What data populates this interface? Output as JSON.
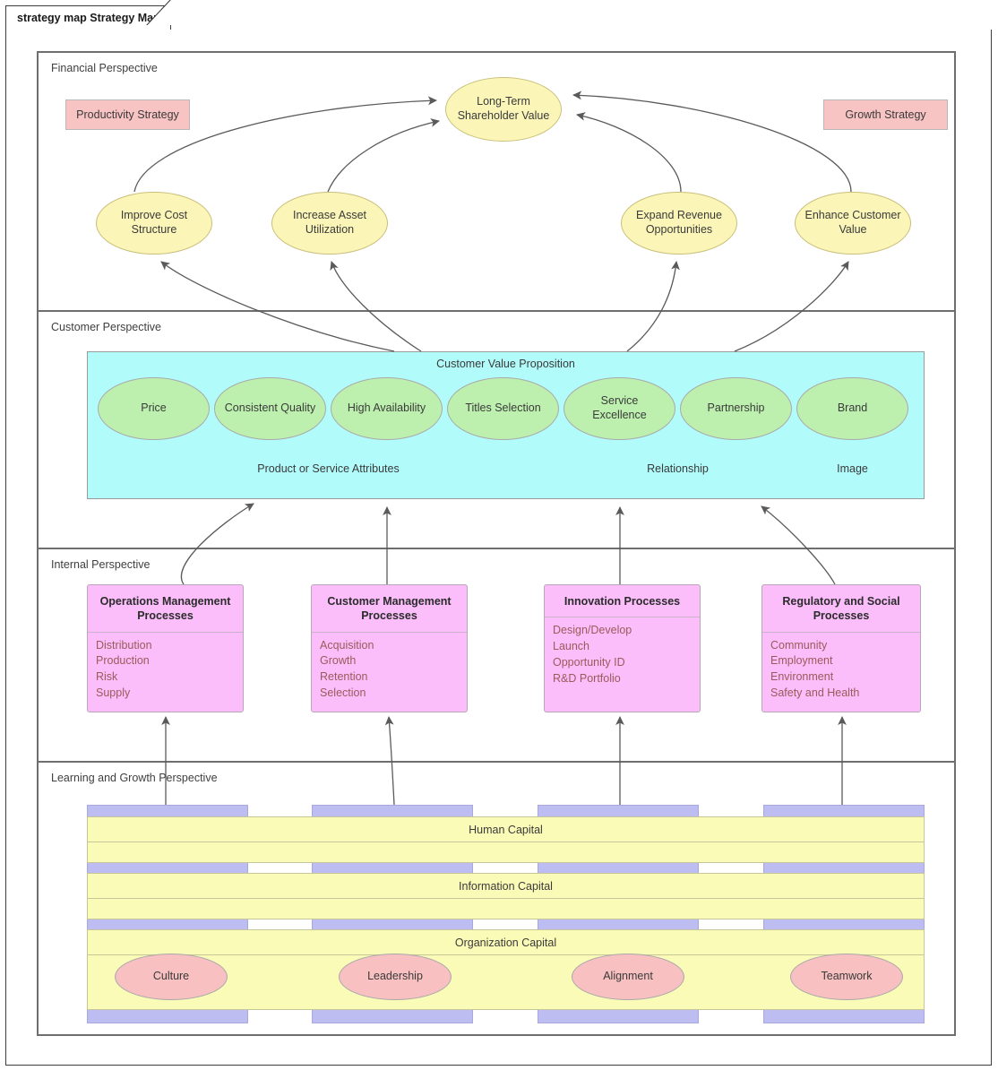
{
  "tab": {
    "label": "strategy map Strategy Map"
  },
  "colors": {
    "financial_ellipse": "#fbf6b8",
    "customer_ellipse": "#bdf0ae",
    "customer_band": "#b2fbfb",
    "process_box": "#fbbefb",
    "strategy_tag": "#f8c3c3",
    "capital_band": "#fbfbb8",
    "capital_bar": "#bdbdf2",
    "org_ellipse": "#f8c0c0",
    "connector": "#5a5a5a",
    "panel_border": "#6e6e6e"
  },
  "perspectives": {
    "financial": {
      "title": "Financial Perspective",
      "productivity_tag": "Productivity Strategy",
      "growth_tag": "Growth Strategy",
      "apex": "Long-Term Shareholder Value",
      "objectives": [
        "Improve Cost Structure",
        "Increase Asset Utilization",
        "Expand Revenue Opportunities",
        "Enhance Customer Value"
      ]
    },
    "customer": {
      "title": "Customer Perspective",
      "proposition_title": "Customer Value Proposition",
      "attributes": [
        "Price",
        "Consistent Quality",
        "High Availability",
        "Titles Selection",
        "Service Excellence",
        "Partnership",
        "Brand"
      ],
      "categories": [
        "Product or Service Attributes",
        "Relationship",
        "Image"
      ]
    },
    "internal": {
      "title": "Internal Perspective",
      "processes": [
        {
          "name": "Operations Management Processes",
          "items": [
            "Distribution",
            "Production",
            "Risk",
            "Supply"
          ]
        },
        {
          "name": "Customer Management Processes",
          "items": [
            "Acquisition",
            "Growth",
            "Retention",
            "Selection"
          ]
        },
        {
          "name": "Innovation Processes",
          "items": [
            "Design/Develop",
            "Launch",
            "Opportunity ID",
            "R&D Portfolio"
          ]
        },
        {
          "name": "Regulatory and Social Processes",
          "items": [
            "Community",
            "Employment",
            "Environment",
            "Safety and Health"
          ]
        }
      ]
    },
    "learning": {
      "title": "Learning and Growth Perspective",
      "capitals": [
        "Human Capital",
        "Information Capital",
        "Organization Capital"
      ],
      "organization_items": [
        "Culture",
        "Leadership",
        "Alignment",
        "Teamwork"
      ]
    }
  }
}
